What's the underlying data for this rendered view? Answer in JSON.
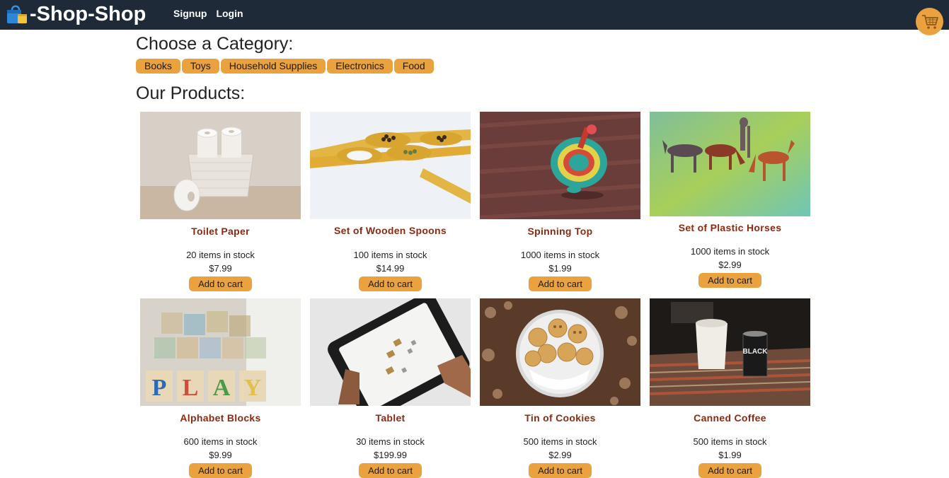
{
  "brand": {
    "title": "-Shop-Shop",
    "icon": "shopping-bag-icon"
  },
  "nav": {
    "links": [
      "Signup",
      "Login"
    ]
  },
  "cart": {
    "icon": "shopping-cart-icon",
    "color": "#eaa23e"
  },
  "colors": {
    "navbar": "#1f2a38",
    "accent": "#eaa23e",
    "product_name": "#8b2a10"
  },
  "categories": {
    "heading": "Choose a Category:",
    "items": [
      "Books",
      "Toys",
      "Household Supplies",
      "Electronics",
      "Food"
    ]
  },
  "products": {
    "heading": "Our Products:",
    "add_label": "Add to cart",
    "items": [
      {
        "name": "Toilet Paper",
        "stock": "20 items in stock",
        "price": "$7.99"
      },
      {
        "name": "Set of Wooden Spoons",
        "stock": "100 items in stock",
        "price": "$14.99"
      },
      {
        "name": "Spinning Top",
        "stock": "1000 items in stock",
        "price": "$1.99"
      },
      {
        "name": "Set of Plastic Horses",
        "stock": "1000 items in stock",
        "price": "$2.99"
      },
      {
        "name": "Alphabet Blocks",
        "stock": "600 items in stock",
        "price": "$9.99"
      },
      {
        "name": "Tablet",
        "stock": "30 items in stock",
        "price": "$199.99"
      },
      {
        "name": "Tin of Cookies",
        "stock": "500 items in stock",
        "price": "$2.99"
      },
      {
        "name": "Canned Coffee",
        "stock": "500 items in stock",
        "price": "$1.99"
      }
    ]
  }
}
